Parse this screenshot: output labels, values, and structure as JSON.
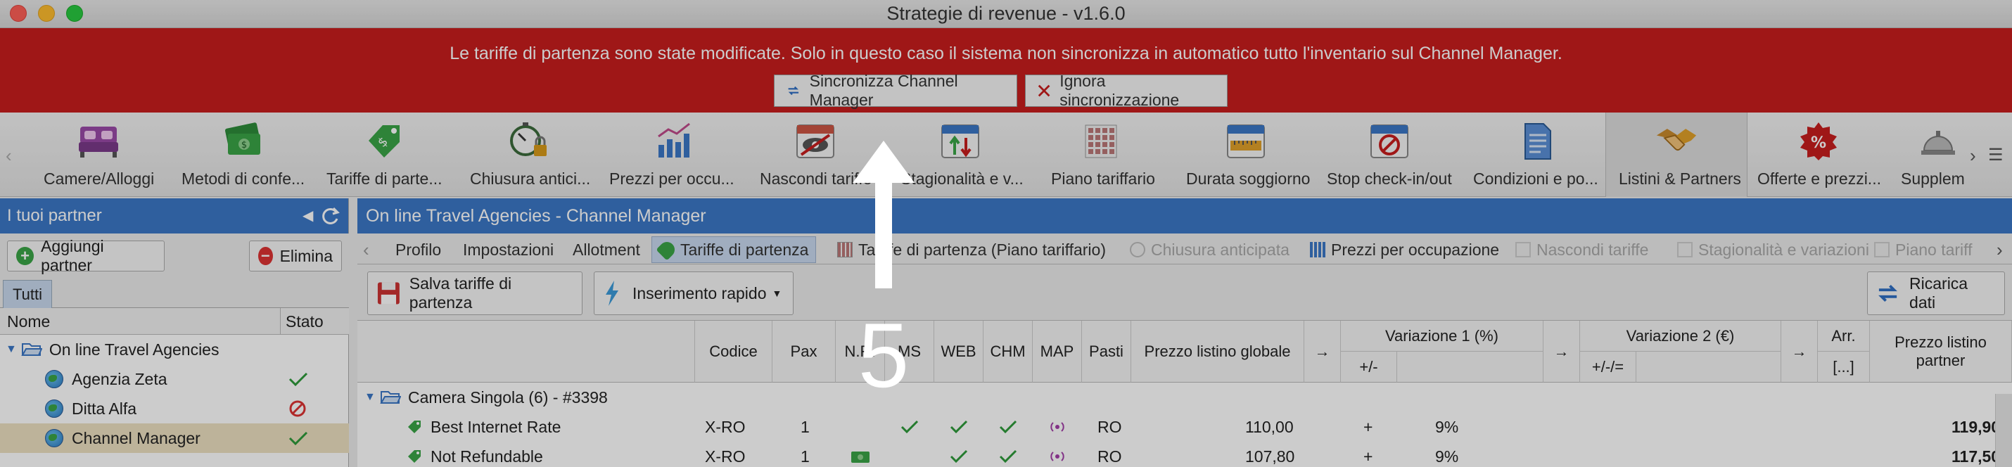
{
  "window": {
    "title": "Strategie di revenue - v1.6.0"
  },
  "banner": {
    "message": "Le tariffe di partenza sono state modificate. Solo in questo caso il sistema non sincronizza in automatico tutto l'inventario sul Channel Manager.",
    "sync_label": "Sincronizza Channel Manager",
    "ignore_label": "Ignora sincronizzazione",
    "color": "#c71d1d"
  },
  "modules": [
    {
      "label": "Camere/Alloggi",
      "icon": "bed-icon"
    },
    {
      "label": "Metodi di confe...",
      "icon": "money-icon"
    },
    {
      "label": "Tariffe di parte...",
      "icon": "price-tag-icon"
    },
    {
      "label": "Chiusura antici...",
      "icon": "stopwatch-lock-icon"
    },
    {
      "label": "Prezzi per occu...",
      "icon": "bar-chart-icon"
    },
    {
      "label": "Nascondi tariffe",
      "icon": "calendar-eye-icon"
    },
    {
      "label": "Stagionalità e v...",
      "icon": "calendar-arrows-icon"
    },
    {
      "label": "Piano tariffario",
      "icon": "grid-plan-icon"
    },
    {
      "label": "Durata soggiorno",
      "icon": "calendar-ruler-icon"
    },
    {
      "label": "Stop check-in/out",
      "icon": "calendar-stop-icon"
    },
    {
      "label": "Condizioni e po...",
      "icon": "document-icon"
    },
    {
      "label": "Listini & Partners",
      "icon": "handshake-icon"
    },
    {
      "label": "Offerte e prezzi...",
      "icon": "discount-badge-icon"
    },
    {
      "label": "Supplem",
      "icon": "service-bell-icon"
    }
  ],
  "left_panel": {
    "title": "I tuoi partner",
    "add_label": "Aggiungi partner",
    "delete_label": "Elimina",
    "tab_label": "Tutti",
    "col_name": "Nome",
    "col_status": "Stato",
    "group": "On line Travel Agencies",
    "partners": [
      {
        "name": "Agenzia Zeta",
        "status": "ok"
      },
      {
        "name": "Ditta Alfa",
        "status": "blocked"
      },
      {
        "name": "Channel Manager",
        "status": "ok"
      }
    ]
  },
  "right_panel": {
    "title": "On line Travel Agencies - Channel Manager",
    "tabs": [
      {
        "label": "Profilo"
      },
      {
        "label": "Impostazioni"
      },
      {
        "label": "Allotment"
      },
      {
        "label": "Tariffe di partenza"
      },
      {
        "label": "Tariffe di partenza (Piano tariffario)"
      },
      {
        "label": "Chiusura anticipata"
      },
      {
        "label": "Prezzi per occupazione"
      },
      {
        "label": "Nascondi tariffe"
      },
      {
        "label": "Stagionalità e variazioni"
      },
      {
        "label": "Piano tariff"
      }
    ],
    "save_label": "Salva tariffe di partenza",
    "quick_label": "Inserimento rapido",
    "reload_label": "Ricarica dati",
    "columns": {
      "code": "Codice",
      "pax": "Pax",
      "nr": "N.R.",
      "ms": "MS",
      "web": "WEB",
      "chm": "CHM",
      "map": "MAP",
      "meals": "Pasti",
      "global_price": "Prezzo listino globale",
      "arrow": "→",
      "var1": "Variazione 1 (%)",
      "var1_sub": "+/-",
      "var2": "Variazione 2 (€)",
      "var2_sub": "+/-/=",
      "arr": "Arr.",
      "arr_sub": "[...]",
      "partner_price": "Prezzo listino partner"
    },
    "room_group": "Camera Singola (6) - #3398",
    "rows": [
      {
        "name": "Best Internet Rate",
        "code": "X-RO",
        "pax": "1",
        "meals": "RO",
        "global": "110,00",
        "sign": "+",
        "pct": "9%",
        "partner": "119,90"
      },
      {
        "name": "Not Refundable",
        "code": "X-RO",
        "pax": "1",
        "meals": "RO",
        "global": "107,80",
        "sign": "+",
        "pct": "9%",
        "partner": "117,50"
      }
    ]
  },
  "overlay": {
    "step": "5"
  }
}
